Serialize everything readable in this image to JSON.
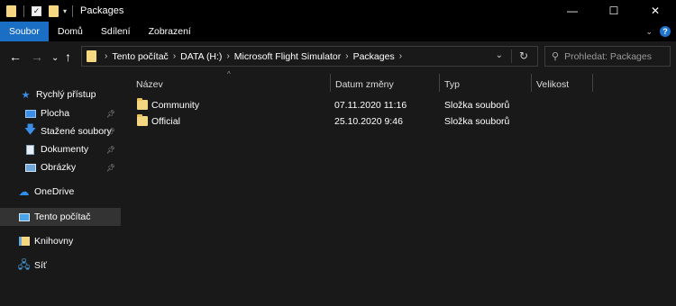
{
  "window": {
    "title": "Packages",
    "controls": {
      "minimize": "—",
      "maximize": "☐",
      "close": "✕"
    }
  },
  "ribbon": {
    "tabs": [
      {
        "label": "Soubor",
        "active": true
      },
      {
        "label": "Domů"
      },
      {
        "label": "Sdílení"
      },
      {
        "label": "Zobrazení"
      }
    ],
    "help": "?"
  },
  "navigation": {
    "back": "←",
    "forward": "→",
    "recent": "⌄",
    "up": "↑"
  },
  "address": {
    "breadcrumbs": [
      "Tento počítač",
      "DATA (H:)",
      "Microsoft Flight Simulator",
      "Packages"
    ]
  },
  "search": {
    "placeholder": "Prohledat: Packages"
  },
  "sidebar": {
    "items": [
      {
        "label": "Rychlý přístup",
        "icon": "star-icon",
        "pinned": false
      },
      {
        "label": "Plocha",
        "icon": "desktop-icon",
        "pinned": true
      },
      {
        "label": "Stažené soubory",
        "icon": "download-icon",
        "pinned": true
      },
      {
        "label": "Dokumenty",
        "icon": "document-icon",
        "pinned": true
      },
      {
        "label": "Obrázky",
        "icon": "pictures-icon",
        "pinned": true
      },
      {
        "label": "OneDrive",
        "icon": "cloud-icon",
        "pinned": false
      },
      {
        "label": "Tento počítač",
        "icon": "computer-icon",
        "pinned": false,
        "selected": true
      },
      {
        "label": "Knihovny",
        "icon": "library-icon",
        "pinned": false
      },
      {
        "label": "Síť",
        "icon": "network-icon",
        "pinned": false
      }
    ]
  },
  "file_list": {
    "columns": [
      "Název",
      "Datum změny",
      "Typ",
      "Velikost"
    ],
    "rows": [
      {
        "name": "Community",
        "date": "07.11.2020 11:16",
        "type": "Složka souborů",
        "size": ""
      },
      {
        "name": "Official",
        "date": "25.10.2020 9:46",
        "type": "Složka souborů",
        "size": ""
      }
    ]
  },
  "colors": {
    "accent": "#1a6ec4",
    "folder": "#f4d780",
    "background": "#191919",
    "titlebar": "#000000"
  }
}
